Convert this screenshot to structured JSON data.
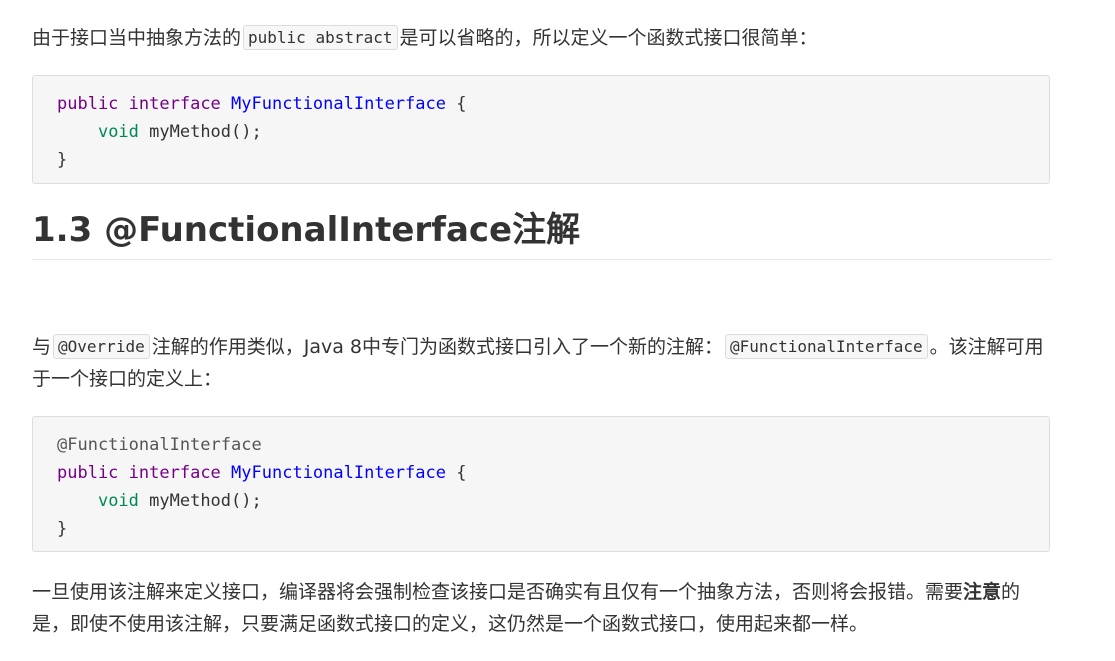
{
  "p1": {
    "before": "由于接口当中抽象方法的",
    "code": "public abstract",
    "after": "是可以省略的，所以定义一个函数式接口很简单："
  },
  "code1": {
    "line1": {
      "kw1": "public",
      "kw2": "interface",
      "name": "MyFunctionalInterface",
      "tail": " {"
    },
    "line2": {
      "indent": "    ",
      "type": "void",
      "rest": " myMethod();"
    },
    "line3": "}"
  },
  "heading": "1.3 @FunctionalInterface注解",
  "p2": {
    "before": "与",
    "code1": "@Override",
    "middle": "注解的作用类似，Java 8中专门为函数式接口引入了一个新的注解：",
    "code2": "@FunctionalInterface",
    "after": "。该注解可用于一个接口的定义上："
  },
  "code2": {
    "line0": "@FunctionalInterface",
    "line1": {
      "kw1": "public",
      "kw2": "interface",
      "name": "MyFunctionalInterface",
      "tail": " {"
    },
    "line2": {
      "indent": "    ",
      "type": "void",
      "rest": " myMethod();"
    },
    "line3": "}"
  },
  "p3": {
    "before": "一旦使用该注解来定义接口，编译器将会强制检查该接口是否确实有且仅有一个抽象方法，否则将会报错。需要",
    "bold": "注意",
    "after": "的是，即使不使用该注解，只要满足函数式接口的定义，这仍然是一个函数式接口，使用起来都一样。"
  }
}
